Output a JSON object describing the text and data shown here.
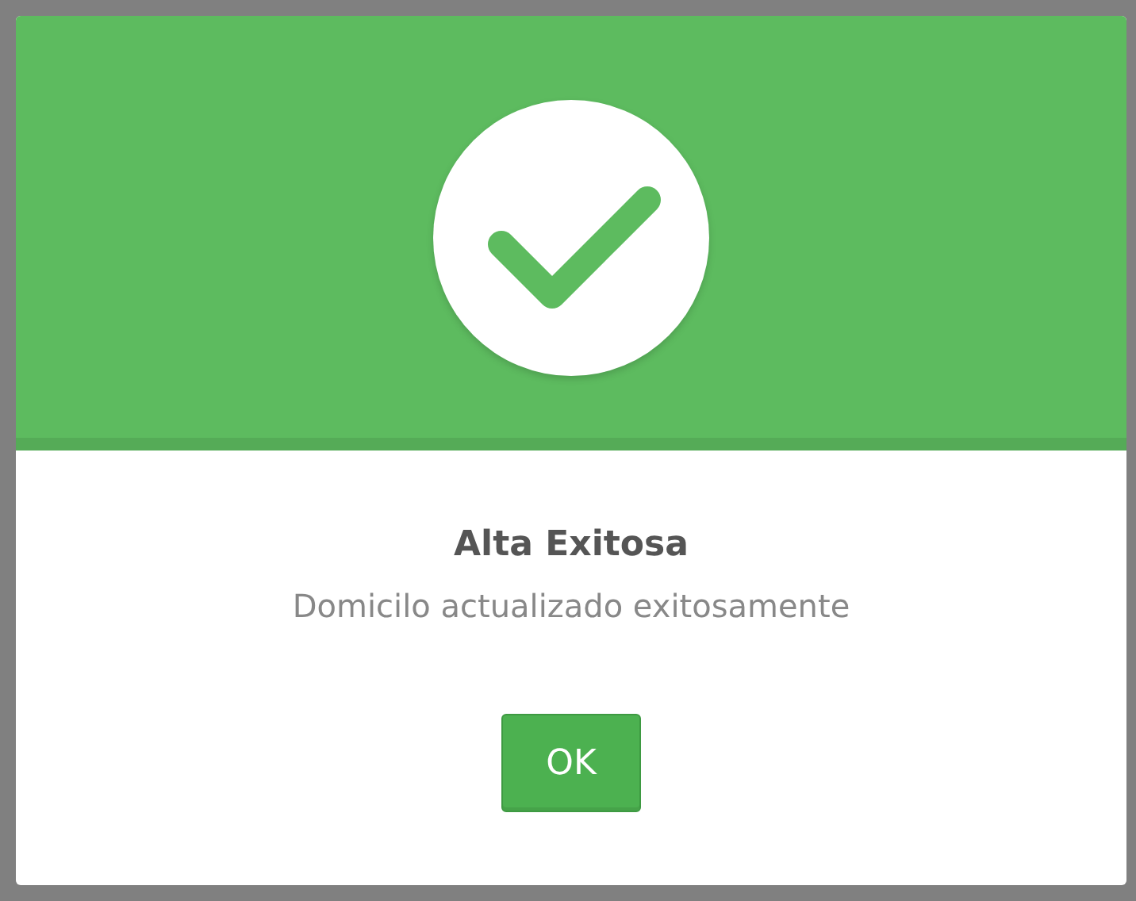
{
  "dialog": {
    "kind": "success",
    "title": "Alta Exitosa",
    "message": "Domicilo actualizado exitosamente",
    "buttons": [
      "OK"
    ]
  }
}
